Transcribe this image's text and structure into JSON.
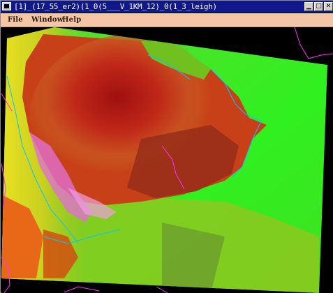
{
  "window": {
    "title": "[1]_(17_55_er2)(1_0(5___V_1KM_12)_0(1_3_leigh)",
    "minimize_glyph": "▁",
    "maximize_glyph": "□",
    "close_glyph": "✕"
  },
  "menu": {
    "items": [
      {
        "label": "File"
      },
      {
        "label": "Window"
      },
      {
        "label": "Help"
      }
    ]
  },
  "colors": {
    "title_bar": "#10188a",
    "menu_bar": "#f4c6a6",
    "image_background": "#000000",
    "coastline": "#00c8ff",
    "borders": "#ff30ff"
  }
}
